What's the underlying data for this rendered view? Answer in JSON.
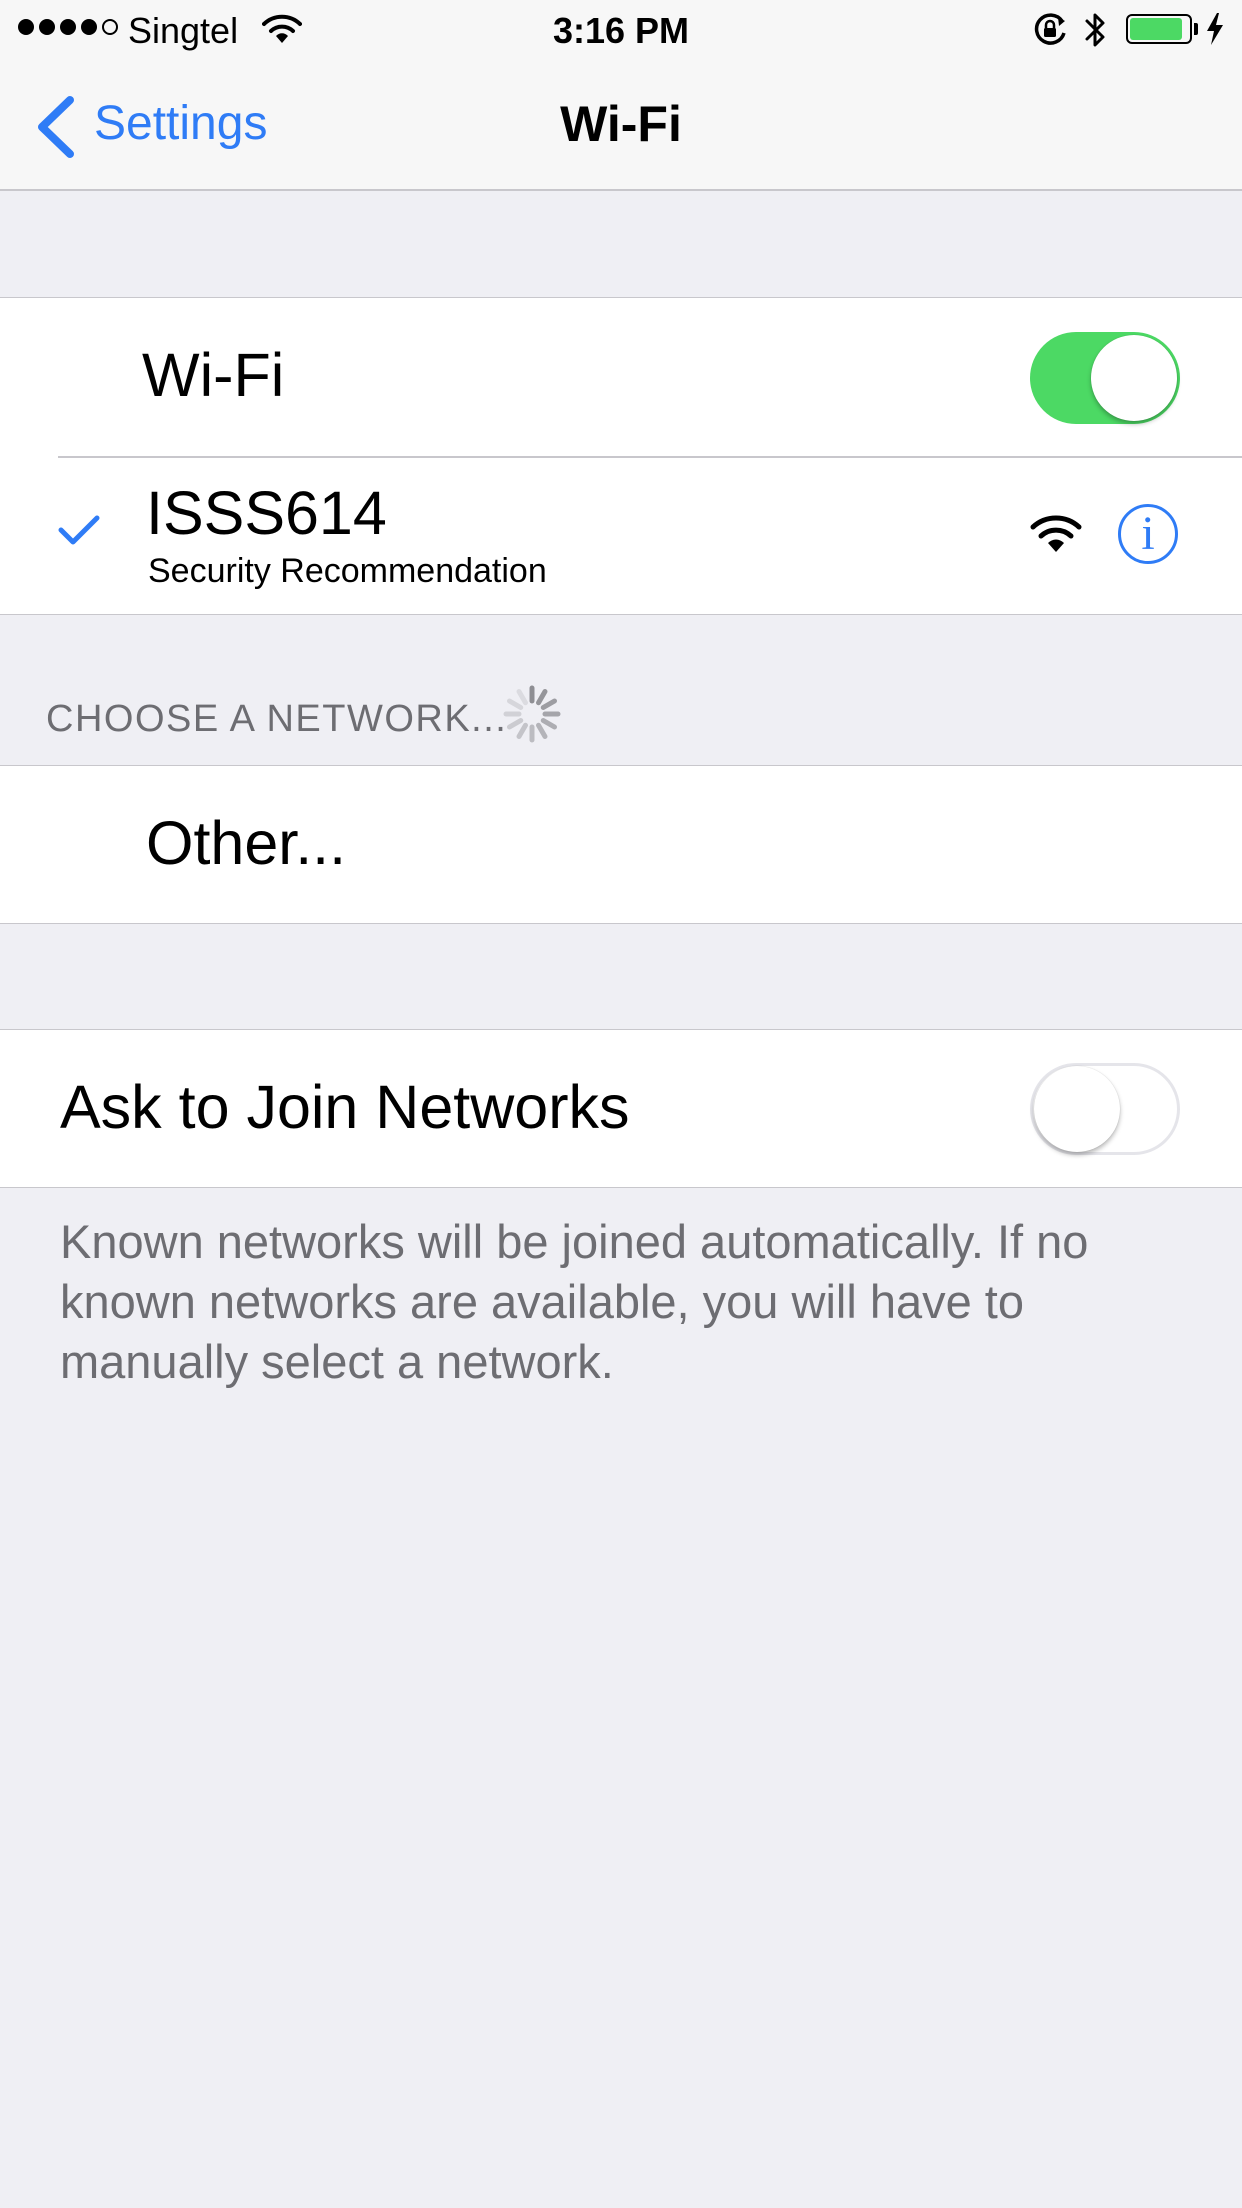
{
  "status_bar": {
    "signal_bars_filled": 4,
    "signal_bars_total": 5,
    "carrier": "Singtel",
    "time": "3:16 PM",
    "battery_level": 0.9,
    "charging": true
  },
  "nav": {
    "back_label": "Settings",
    "title": "Wi-Fi"
  },
  "wifi_group": {
    "toggle_label": "Wi-Fi",
    "toggle_on": true,
    "connected_network": {
      "name": "ISSS614",
      "subtitle": "Security Recommendation",
      "selected": true
    }
  },
  "choose_section": {
    "header": "CHOOSE A NETWORK...",
    "other_label": "Other..."
  },
  "ask_join": {
    "label": "Ask to Join Networks",
    "toggle_on": false,
    "footer": "Known networks will be joined automatically. If no known networks are available, you will have to manually select a network."
  },
  "colors": {
    "accent": "#2f7cf6",
    "toggle_on": "#4cd964",
    "background": "#efeff4",
    "secondary_text": "#6d6d72"
  },
  "icons": [
    "back-chevron-icon",
    "wifi-signal-icon",
    "lock-rotation-icon",
    "bluetooth-icon",
    "battery-icon",
    "charging-bolt-icon",
    "checkmark-icon",
    "info-icon",
    "loading-spinner-icon"
  ]
}
